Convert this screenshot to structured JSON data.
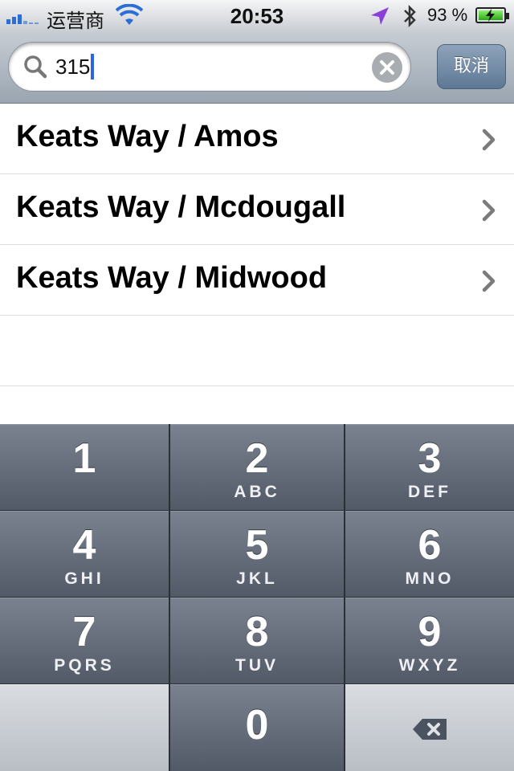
{
  "status_bar": {
    "carrier": "运营商",
    "time": "20:53",
    "battery_percent": "93 %"
  },
  "search": {
    "value": "315",
    "cancel_label": "取消"
  },
  "results": [
    {
      "label": "Keats Way / Amos"
    },
    {
      "label": "Keats Way / Mcdougall"
    },
    {
      "label": "Keats Way / Midwood"
    }
  ],
  "keypad": {
    "k1": {
      "digit": "1",
      "letters": ""
    },
    "k2": {
      "digit": "2",
      "letters": "ABC"
    },
    "k3": {
      "digit": "3",
      "letters": "DEF"
    },
    "k4": {
      "digit": "4",
      "letters": "GHI"
    },
    "k5": {
      "digit": "5",
      "letters": "JKL"
    },
    "k6": {
      "digit": "6",
      "letters": "MNO"
    },
    "k7": {
      "digit": "7",
      "letters": "PQRS"
    },
    "k8": {
      "digit": "8",
      "letters": "TUV"
    },
    "k9": {
      "digit": "9",
      "letters": "WXYZ"
    },
    "k0": {
      "digit": "0",
      "letters": ""
    }
  },
  "icons": {
    "signal": "signal-bars-icon",
    "wifi": "wifi-icon",
    "location": "location-arrow-icon",
    "bluetooth": "bluetooth-icon",
    "battery": "battery-charging-icon",
    "search": "magnifier-icon",
    "clear": "clear-x-icon",
    "chevron": "chevron-right-icon",
    "delete": "backspace-icon"
  },
  "colors": {
    "signal": "#2b6fd6",
    "wifi": "#2b6fd6",
    "location": "#8b3fd8",
    "caret": "#2e63e6",
    "battery_fill": "#2aa618"
  }
}
